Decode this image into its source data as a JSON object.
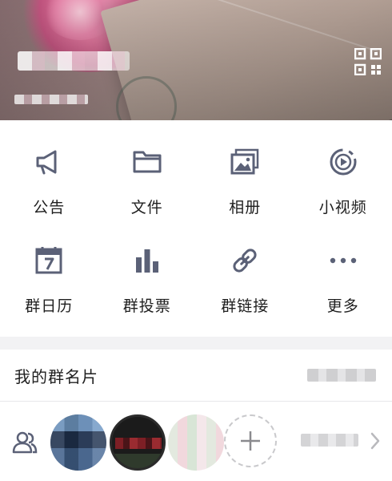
{
  "header": {
    "qr_icon": "qr-code-icon"
  },
  "features": [
    {
      "label": "公告",
      "icon": "megaphone-icon"
    },
    {
      "label": "文件",
      "icon": "folder-icon"
    },
    {
      "label": "相册",
      "icon": "photo-album-icon"
    },
    {
      "label": "小视频",
      "icon": "video-play-icon"
    },
    {
      "label": "群日历",
      "icon": "calendar-icon"
    },
    {
      "label": "群投票",
      "icon": "bar-chart-icon"
    },
    {
      "label": "群链接",
      "icon": "link-icon"
    },
    {
      "label": "更多",
      "icon": "more-dots-icon"
    }
  ],
  "my_card": {
    "label": "我的群名片"
  },
  "members": {
    "icon": "members-icon",
    "add_icon": "plus-icon",
    "chevron": "chevron-right-icon"
  },
  "colors": {
    "icon": "#5b6177",
    "text": "#1f1f1f",
    "separator": "#f2f2f4"
  }
}
